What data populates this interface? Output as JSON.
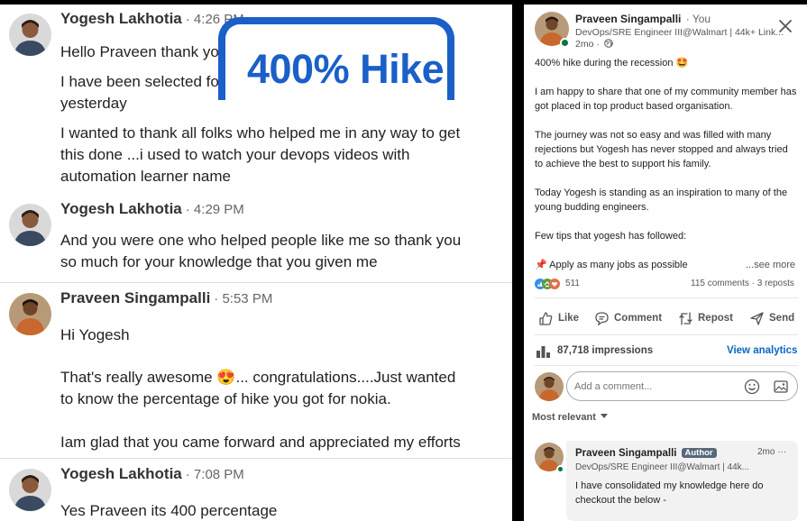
{
  "chat": {
    "badge": "400% Hike",
    "groups": [
      {
        "sender": "Yogesh Lakhotia",
        "time": "· 4:26 PM",
        "lines": [
          "Hello Praveen thank yo",
          "I have been selected fo",
          "yesterday",
          "I wanted to thank all folks who helped me in any way to get",
          "this done ...i used to watch your devops videos with",
          "automation learner name"
        ]
      },
      {
        "sender": "Yogesh Lakhotia",
        "time": "· 4:29 PM",
        "lines": [
          "And you were one who helped people like me so thank you",
          "so much for your knowledge that you given me"
        ]
      },
      {
        "sender": "Praveen Singampalli",
        "time": "· 5:53 PM",
        "lines": [
          "Hi Yogesh",
          "That's really awesome 😍... congratulations....Just wanted",
          "to know the percentage of hike you got for nokia.",
          "Iam glad that you came forward and appreciated my efforts"
        ]
      },
      {
        "sender": "Yogesh Lakhotia",
        "time": "· 7:08 PM",
        "lines": [
          "Yes Praveen its 400 percentage"
        ]
      }
    ]
  },
  "post": {
    "author": "Praveen Singampalli",
    "you_label": "· You",
    "headline": "DevOps/SRE Engineer III@Walmart | 44k+ Link...",
    "age": "2mo ·",
    "paragraphs": [
      "400% hike during the recession 🤩",
      "I am happy to share that one of my community member has got placed in top product based organisation.",
      "The journey was not so easy and was filled with many rejections but Yogesh has never stopped and always tried to achieve the best to support his family.",
      "Today Yogesh is standing as an inspiration to many of the young budding engineers.",
      "Few tips that yogesh has followed:",
      "📌 Apply as many jobs as possible"
    ],
    "see_more": "...see more",
    "reaction_count": "511",
    "comment_stats": "115 comments · 3 reposts",
    "actions": {
      "like": "Like",
      "comment": "Comment",
      "repost": "Repost",
      "send": "Send"
    },
    "impressions": "87,718 impressions",
    "view_analytics": "View analytics",
    "comment_placeholder": "Add a comment...",
    "sort_label": "Most relevant",
    "top_comment": {
      "author": "Praveen Singampalli",
      "badge": "Author",
      "time": "2mo ···",
      "headline": "DevOps/SRE Engineer III@Walmart | 44k...",
      "text": "I have consolidated my knowledge here do checkout the below -"
    }
  },
  "colors": {
    "accent": "#0a66c2",
    "badge_blue": "#1b5fc8",
    "online": "#057642"
  }
}
